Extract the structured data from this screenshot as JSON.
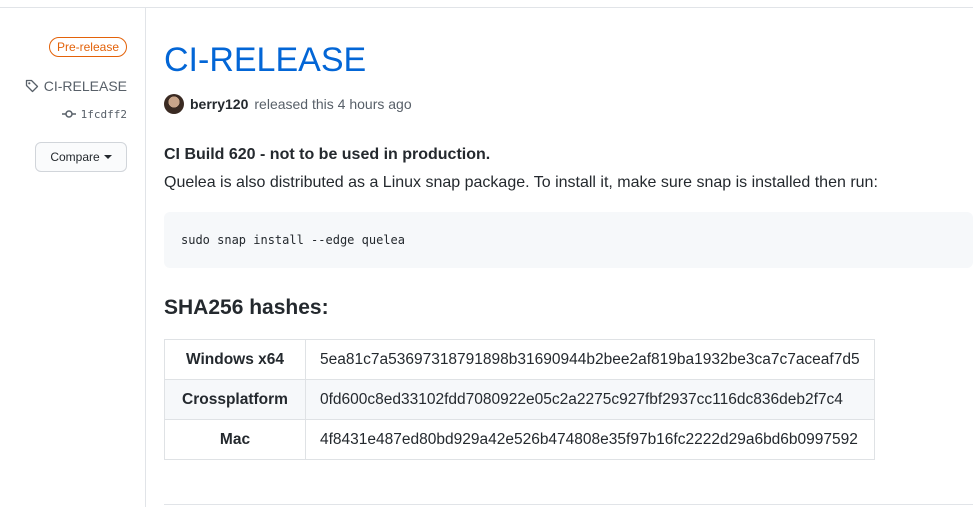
{
  "sidebar": {
    "badge": "Pre-release",
    "tag_label": "CI-RELEASE",
    "commit_sha": "1fcdff2",
    "compare_label": "Compare"
  },
  "release": {
    "title": "CI-RELEASE",
    "author": "berry120",
    "released_text": "released this 4 hours ago",
    "notice": "CI Build 620 - not to be used in production.",
    "description": "Quelea is also distributed as a Linux snap package. To install it, make sure snap is installed then run:",
    "code": "sudo snap install --edge quelea",
    "hashes_title": "SHA256 hashes:",
    "hashes": [
      {
        "platform": "Windows x64",
        "hash": "5ea81c7a53697318791898b31690944b2bee2af819ba1932be3ca7c7aceaf7d5"
      },
      {
        "platform": "Crossplatform",
        "hash": "0fd600c8ed33102fdd7080922e05c2a2275c927fbf2937cc116dc836deb2f7c4"
      },
      {
        "platform": "Mac",
        "hash": "4f8431e487ed80bd929a42e526b474808e35f97b16fc2222d29a6bd6b0997592"
      }
    ]
  },
  "icons": {
    "tag": "tag-icon",
    "commit": "git-commit-icon",
    "avatar": "avatar"
  }
}
